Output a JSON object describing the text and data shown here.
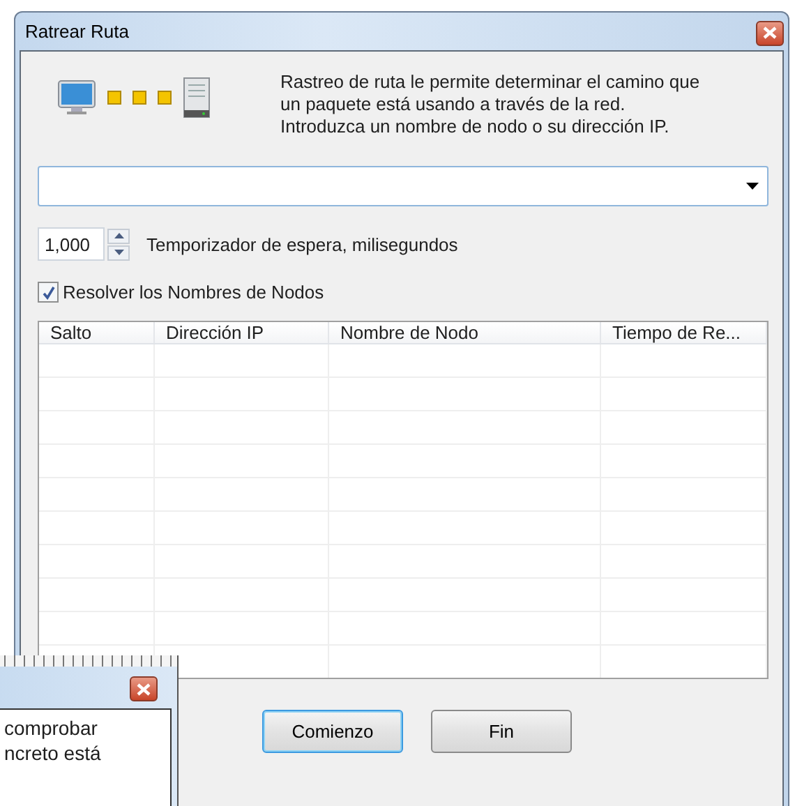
{
  "window": {
    "title": "Ratrear Ruta"
  },
  "description": "Rastreo de ruta le permite determinar el camino que\nun paquete está usando a través de la red.\nIntroduzca un nombre de nodo o su dirección IP.",
  "timeout": {
    "value": "1,000",
    "label": "Temporizador de espera, milisegundos"
  },
  "resolve_names": {
    "label": "Resolver los Nombres de Nodos",
    "checked": true
  },
  "table": {
    "columns": [
      "Salto",
      "Dirección IP",
      "Nombre de Nodo",
      "Tiempo de Re..."
    ]
  },
  "buttons": [
    {
      "label": "Comienzo",
      "default": true
    },
    {
      "label": "Fin",
      "default": false
    }
  ],
  "background_window": {
    "lines": [
      "comprobar",
      "ncreto está"
    ]
  }
}
